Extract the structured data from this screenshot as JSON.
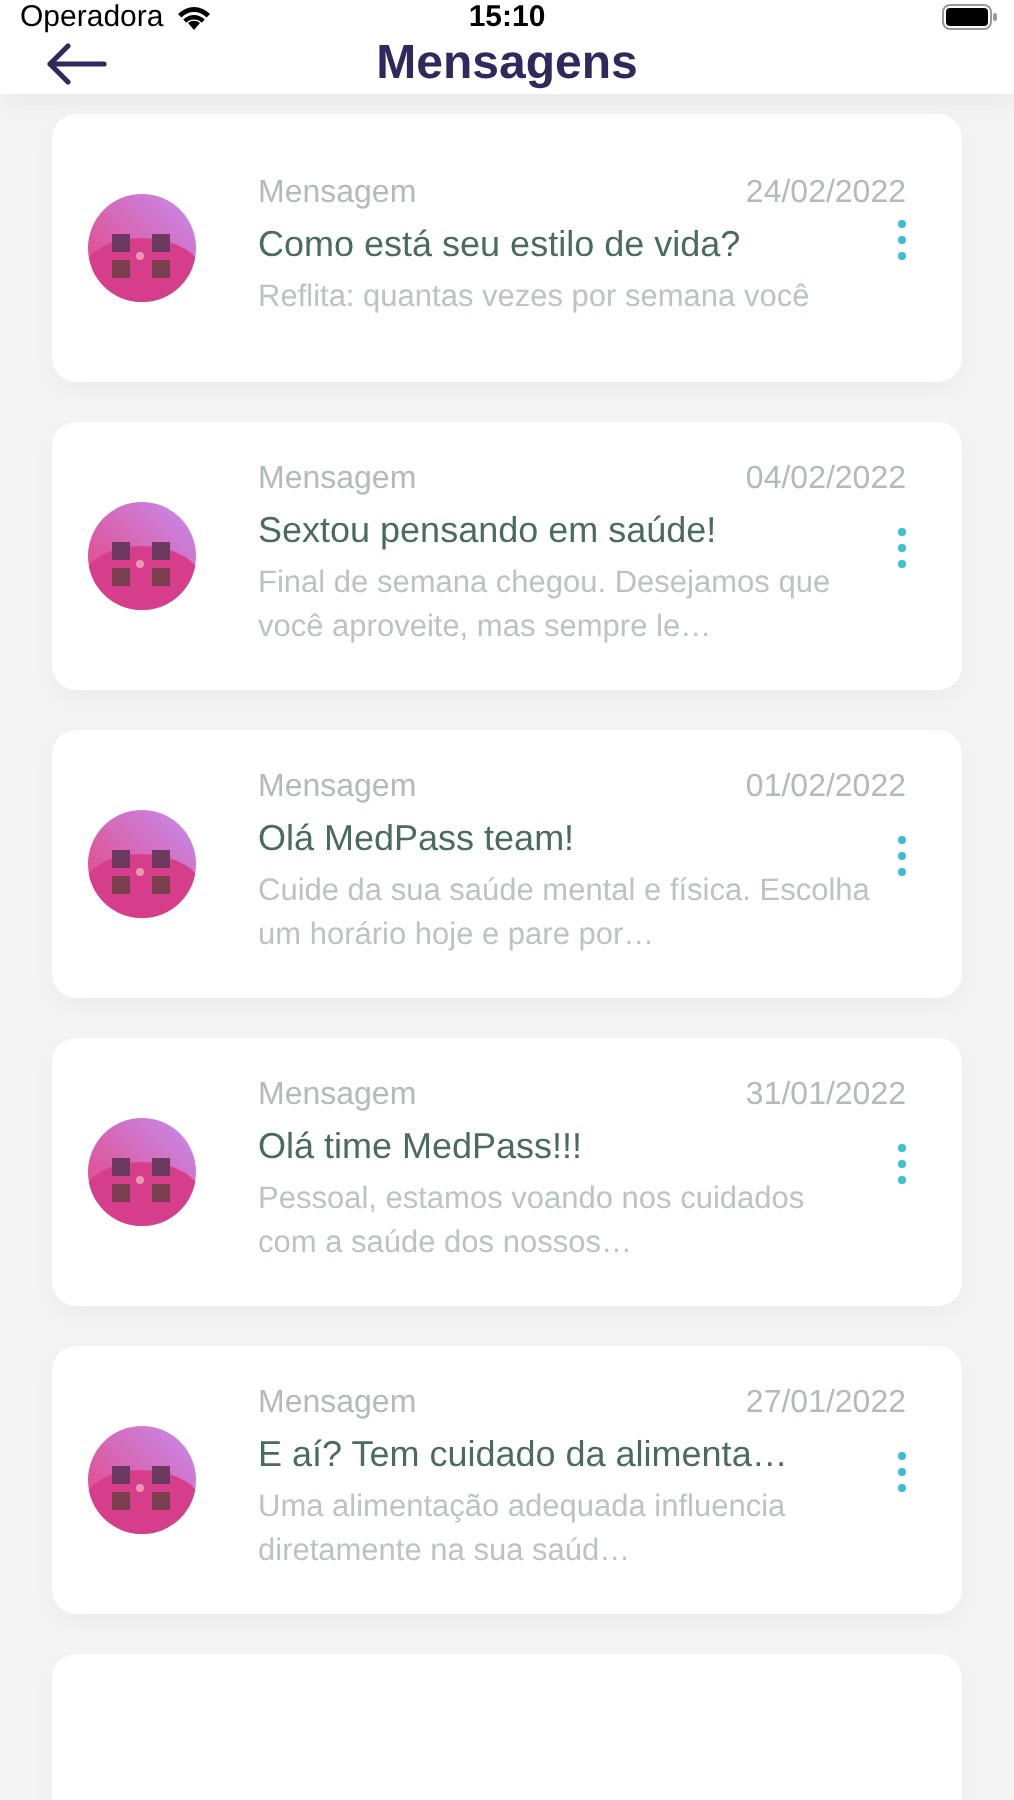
{
  "status_bar": {
    "carrier": "Operadora",
    "time": "15:10"
  },
  "header": {
    "title": "Mensagens"
  },
  "messages": [
    {
      "label": "Mensagem",
      "date": "24/02/2022",
      "title": "Como está seu estilo de vida?",
      "preview": "Reflita: quantas vezes por semana você"
    },
    {
      "label": "Mensagem",
      "date": "04/02/2022",
      "title": "Sextou pensando em saúde!",
      "preview": "Final de semana chegou. Desejamos que você aproveite, mas sempre le…"
    },
    {
      "label": "Mensagem",
      "date": "01/02/2022",
      "title": "Olá MedPass team!",
      "preview": "Cuide da sua saúde mental e física. Escolha um horário hoje e pare por…"
    },
    {
      "label": "Mensagem",
      "date": "31/01/2022",
      "title": "Olá time MedPass!!!",
      "preview": "Pessoal, estamos voando nos cuidados com a saúde dos nossos…"
    },
    {
      "label": "Mensagem",
      "date": "27/01/2022",
      "title": "E aí? Tem cuidado da alimenta…",
      "preview": "Uma alimentação adequada influencia diretamente na sua saúd…"
    }
  ]
}
